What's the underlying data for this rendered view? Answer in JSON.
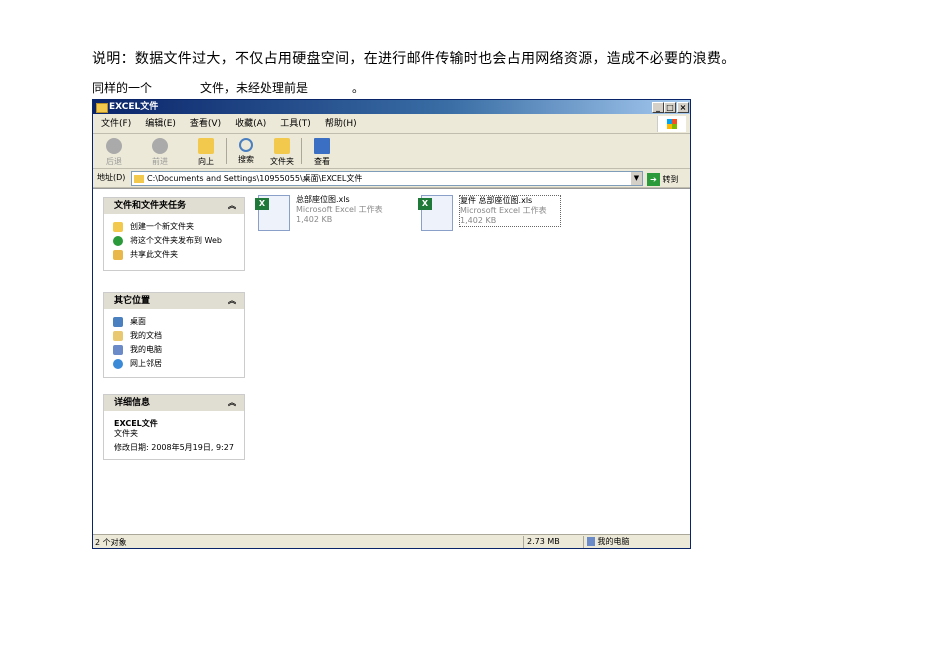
{
  "doc": {
    "line1": "说明：数据文件过大，不仅占用硬盘空间，在进行邮件传输时也会占用网络资源，造成不必要的浪费。",
    "line2_a": "同样的一个",
    "line2_b": "文件，未经处理前是",
    "line2_c": "。"
  },
  "window": {
    "title": "EXCEL文件",
    "min": "_",
    "max": "□",
    "close": "×",
    "menu": [
      "文件(F)",
      "编辑(E)",
      "查看(V)",
      "收藏(A)",
      "工具(T)",
      "帮助(H)"
    ],
    "toolbar": {
      "back": "后退",
      "forward": "前进",
      "up": "向上",
      "search": "搜索",
      "folders": "文件夹",
      "views": "查看"
    },
    "address": {
      "label": "地址(D)",
      "value": "C:\\Documents and Settings\\10955055\\桌面\\EXCEL文件",
      "go": "转到"
    },
    "panes": [
      {
        "title": "文件和文件夹任务",
        "items": [
          "创建一个新文件夹",
          "将这个文件夹发布到 Web",
          "共享此文件夹"
        ]
      },
      {
        "title": "其它位置",
        "items": [
          "桌面",
          "我的文档",
          "我的电脑",
          "网上邻居"
        ]
      },
      {
        "title": "详细信息",
        "name": "EXCEL文件",
        "type": "文件夹",
        "modified": "修改日期: 2008年5月19日, 9:27"
      }
    ],
    "files": [
      {
        "name": "总部座位图.xls",
        "type": "Microsoft Excel 工作表",
        "size": "1,402 KB"
      },
      {
        "name": "复件 总部座位图.xls",
        "type": "Microsoft Excel 工作表",
        "size": "1,402 KB"
      }
    ],
    "status": {
      "count": "2 个对象",
      "size": "2.73 MB",
      "location": "我的电脑"
    }
  }
}
